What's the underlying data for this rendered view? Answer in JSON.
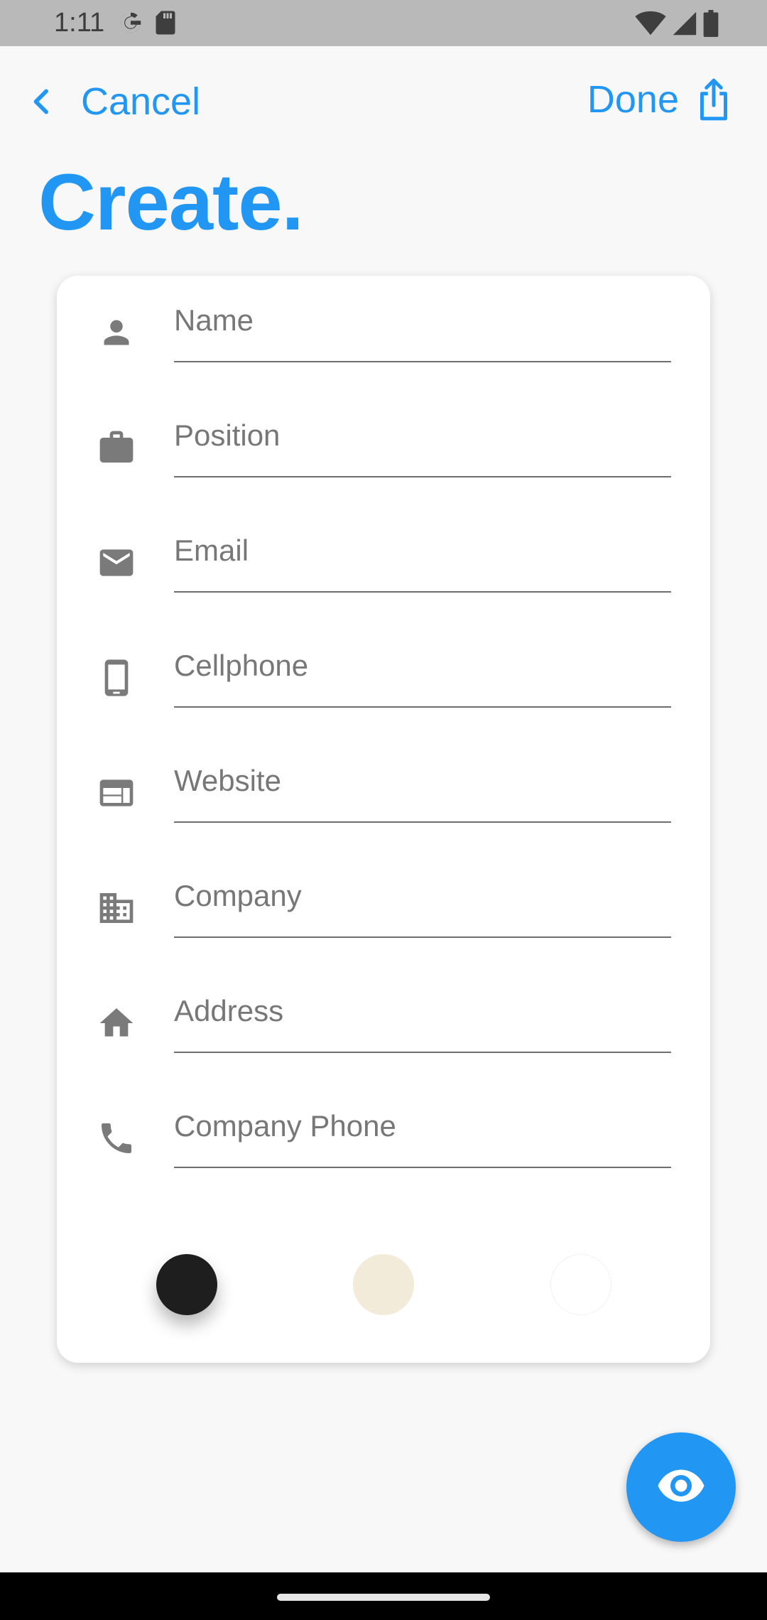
{
  "status_bar": {
    "time": "1:11",
    "left_icons": [
      "google-icon",
      "sd-card-icon"
    ],
    "right_icons": [
      "wifi-icon",
      "cell-signal-icon",
      "battery-icon"
    ]
  },
  "nav": {
    "cancel_label": "Cancel",
    "done_label": "Done"
  },
  "page": {
    "title": "Create."
  },
  "form": {
    "fields": [
      {
        "placeholder": "Name",
        "icon": "person-icon",
        "value": ""
      },
      {
        "placeholder": "Position",
        "icon": "briefcase-icon",
        "value": ""
      },
      {
        "placeholder": "Email",
        "icon": "email-icon",
        "value": ""
      },
      {
        "placeholder": "Cellphone",
        "icon": "smartphone-icon",
        "value": ""
      },
      {
        "placeholder": "Website",
        "icon": "web-icon",
        "value": ""
      },
      {
        "placeholder": "Company",
        "icon": "business-icon",
        "value": ""
      },
      {
        "placeholder": "Address",
        "icon": "home-icon",
        "value": ""
      },
      {
        "placeholder": "Company Phone",
        "icon": "phone-icon",
        "value": ""
      }
    ]
  },
  "color_options": [
    {
      "name": "black",
      "color": "#1e1e1e"
    },
    {
      "name": "cream",
      "color": "#f2ebd9"
    },
    {
      "name": "white",
      "color": "#ffffff"
    }
  ],
  "colors": {
    "accent": "#2196f3",
    "icon_gray": "#7a7a7a"
  },
  "fab": {
    "icon": "eye-icon"
  }
}
